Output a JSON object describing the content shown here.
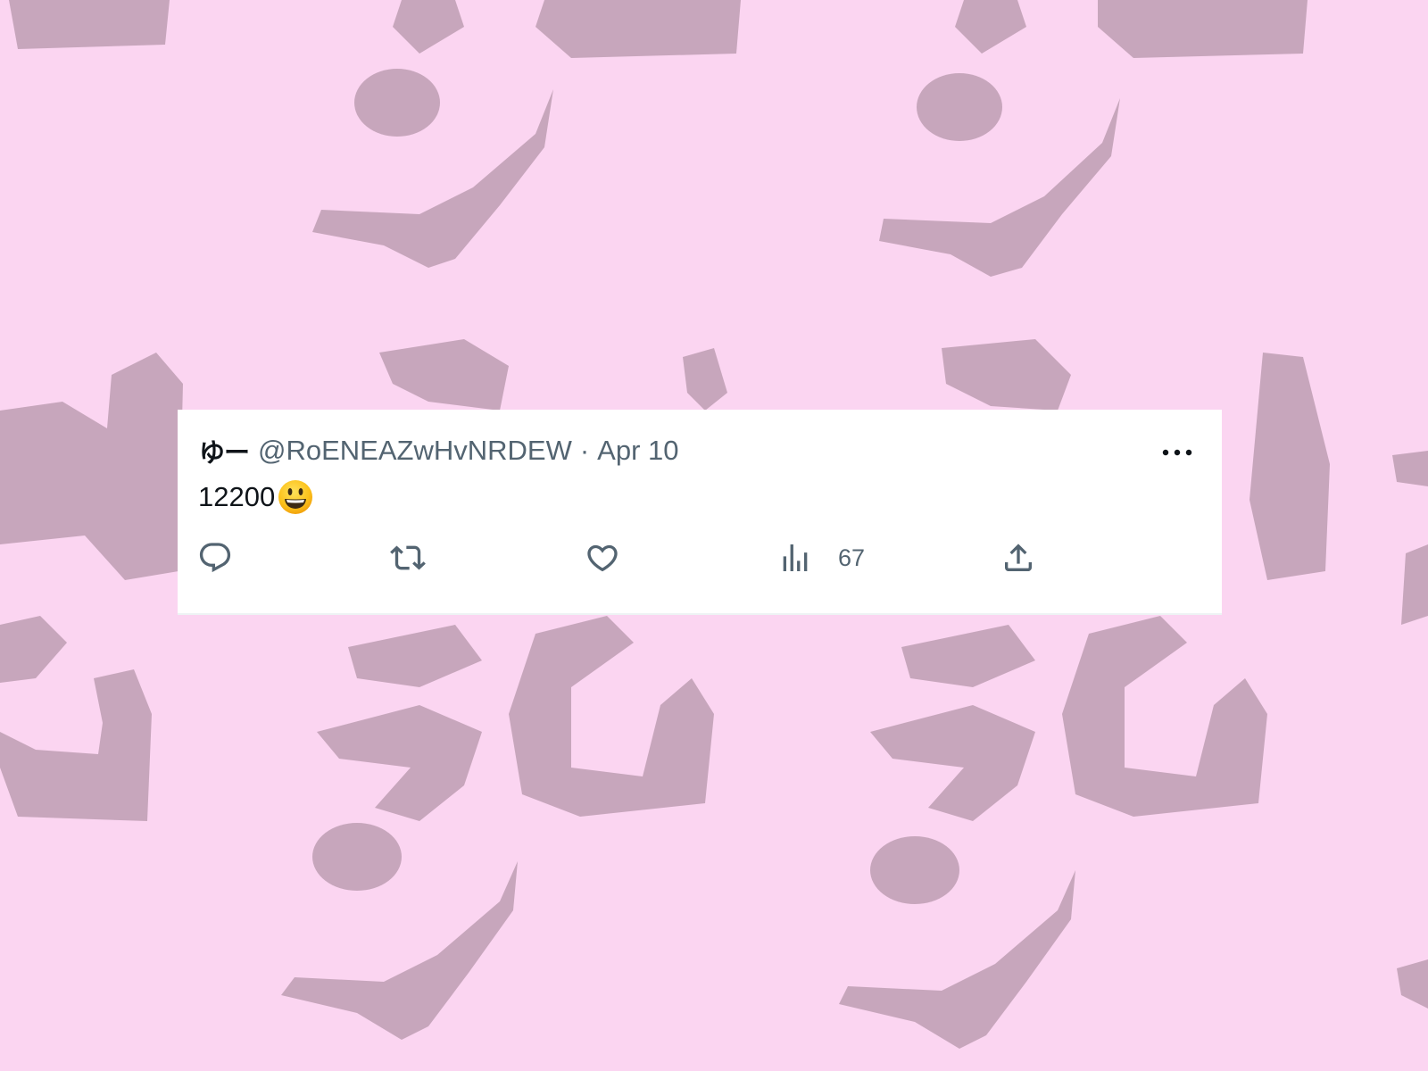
{
  "background": {
    "color": "#fbd5f1",
    "watermark_color": "#c7a6bc"
  },
  "tweet": {
    "display_name": "ゆー",
    "handle": "@RoENEAZwHvNRDEW",
    "separator": "·",
    "date": "Apr 10",
    "text": "12200",
    "emoji": "grinning-face",
    "more_icon": "more-horizontal-icon",
    "actions": {
      "reply": {
        "icon": "reply-icon"
      },
      "repost": {
        "icon": "repost-icon"
      },
      "like": {
        "icon": "like-icon"
      },
      "views": {
        "icon": "views-icon",
        "count": "67"
      },
      "share": {
        "icon": "share-icon"
      }
    }
  },
  "colors": {
    "text_primary": "#0f1419",
    "text_secondary": "#536471",
    "card_bg": "#ffffff"
  }
}
